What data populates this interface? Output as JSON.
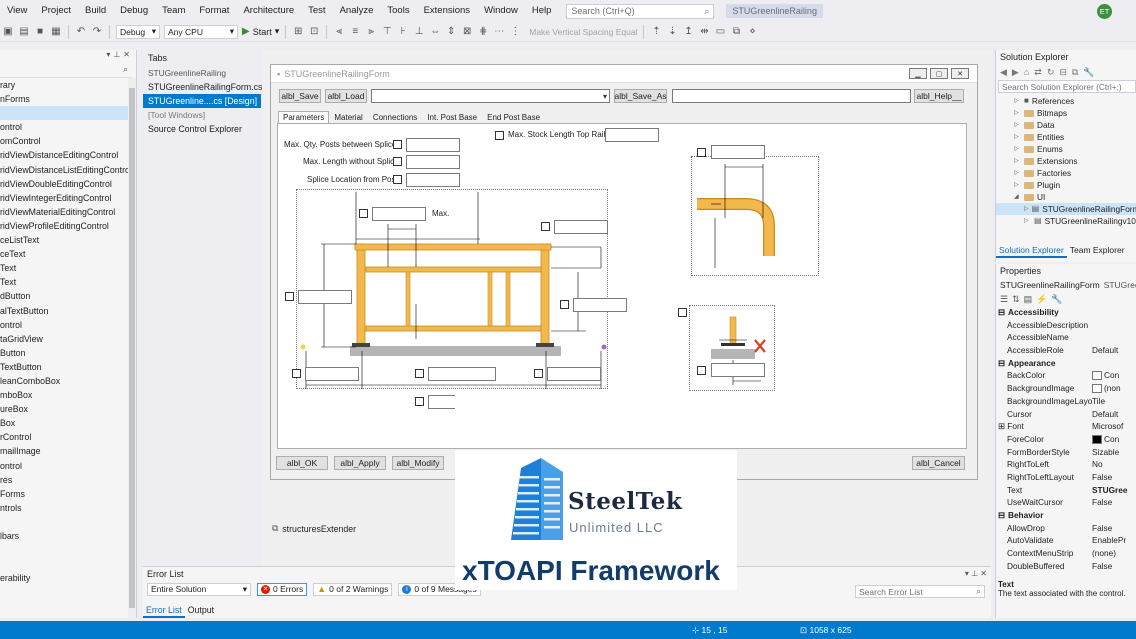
{
  "menubar": {
    "items": [
      "View",
      "Project",
      "Build",
      "Debug",
      "Team",
      "Format",
      "Architecture",
      "Test",
      "Analyze",
      "Tools",
      "Extensions",
      "Window",
      "Help"
    ],
    "search_placeholder": "Search (Ctrl+Q)",
    "title": "STUGreenlineRailing",
    "avatar_initials": "ET"
  },
  "toolbar": {
    "config": "Debug",
    "platform": "Any CPU",
    "start_label": "Start",
    "spacing_label": "Make Vertical Spacing Equal"
  },
  "toolbox": {
    "items": [
      "rary",
      "nForms",
      "",
      "ontrol",
      "omControl",
      "ridViewDistanceEditingControl",
      "ridViewDistanceListEditingControl",
      "ridViewDoubleEditingControl",
      "ridViewIntegerEditingControl",
      "ridViewMaterialEditingControl",
      "ridViewProfileEditingControl",
      "ceListText",
      "ceText",
      "Text",
      "Text",
      "dButton",
      "alTextButton",
      "ontrol",
      "taGridView",
      "Button",
      "TextButton",
      "leanComboBox",
      "mboBox",
      "ureBox",
      "Box",
      "rControl",
      "mailImage",
      "ontrol",
      "res",
      "Forms",
      "ntrols",
      "",
      "lbars",
      "",
      "",
      "erability"
    ],
    "selected_index": 2
  },
  "tabs_panel": {
    "title": "Tabs",
    "section": "STUGreenlineRailing",
    "file": "STUGreenlineRailingForm.cs",
    "active_file": "STUGreenline....cs [Design]",
    "tool_windows": "[Tool Windows]",
    "source_control": "Source Control Explorer"
  },
  "form": {
    "title": "STUGreenlineRailingForm",
    "top_buttons": {
      "save": "albl_Save",
      "load": "albl_Load",
      "save_as": "albl_Save_As",
      "help": "albl_Help__"
    },
    "tabs": [
      "Parameters",
      "Material",
      "Connections",
      "Int. Post Base",
      "End Post Base"
    ],
    "active_tab": 0,
    "labels": {
      "max_stock": "Max. Stock Length Top Rail",
      "max_qty": "Max. Qty. Posts between Splices",
      "max_length": "Max. Length without Splice",
      "splice_location": "Splice Location from Post",
      "max": "Max."
    },
    "bottom_buttons": {
      "ok": "albl_OK",
      "apply": "albl_Apply",
      "modify": "albl_Modify",
      "cancel": "albl_Cancel"
    }
  },
  "extender": "structuresExtender",
  "error_list": {
    "title": "Error List",
    "scope": "Entire Solution",
    "errors": "0 Errors",
    "warnings": "0 of 2 Warnings",
    "messages": "0 of 9 Messages",
    "search_placeholder": "Search Error List",
    "tabs": [
      "Error List",
      "Output"
    ]
  },
  "solution_explorer": {
    "title": "Solution Explorer",
    "search_placeholder": "Search Solution Explorer (Ctrl+;)",
    "items": [
      {
        "label": "References",
        "kind": "refs",
        "indent": 18
      },
      {
        "label": "Bitmaps",
        "kind": "folder",
        "indent": 18
      },
      {
        "label": "Data",
        "kind": "folder",
        "indent": 18
      },
      {
        "label": "Entities",
        "kind": "folder",
        "indent": 18
      },
      {
        "label": "Enums",
        "kind": "folder",
        "indent": 18
      },
      {
        "label": "Extensions",
        "kind": "folder",
        "indent": 18
      },
      {
        "label": "Factories",
        "kind": "folder",
        "indent": 18
      },
      {
        "label": "Plugin",
        "kind": "folder",
        "indent": 18
      },
      {
        "label": "UI",
        "kind": "folder-open",
        "indent": 18
      },
      {
        "label": "STUGreenlineRailingForm",
        "kind": "form",
        "indent": 28,
        "selected": true
      },
      {
        "label": "STUGreenlineRailingv10",
        "kind": "form",
        "indent": 28
      }
    ],
    "tabs": [
      "Solution Explorer",
      "Team Explorer"
    ]
  },
  "properties": {
    "title": "Properties",
    "object": "STUGreenlineRailingForm",
    "object_type": "STUGreenl",
    "rows": [
      {
        "cat": "Accessibility"
      },
      {
        "name": "AccessibleDescription",
        "value": ""
      },
      {
        "name": "AccessibleName",
        "value": ""
      },
      {
        "name": "AccessibleRole",
        "value": "Default"
      },
      {
        "cat": "Appearance"
      },
      {
        "name": "BackColor",
        "value": "Con",
        "swatch": "white"
      },
      {
        "name": "BackgroundImage",
        "value": "(non",
        "swatch": "white"
      },
      {
        "name": "BackgroundImageLayout",
        "value": "Tile"
      },
      {
        "name": "Cursor",
        "value": "Default"
      },
      {
        "name": "Font",
        "value": "Microsof",
        "expand": true
      },
      {
        "name": "ForeColor",
        "value": "Con",
        "swatch": "black"
      },
      {
        "name": "FormBorderStyle",
        "value": "Sizable"
      },
      {
        "name": "RightToLeft",
        "value": "No"
      },
      {
        "name": "RightToLeftLayout",
        "value": "False"
      },
      {
        "name": "Text",
        "value": "STUGree",
        "bold": true
      },
      {
        "name": "UseWaitCursor",
        "value": "False"
      },
      {
        "cat": "Behavior"
      },
      {
        "name": "AllowDrop",
        "value": "False"
      },
      {
        "name": "AutoValidate",
        "value": "EnablePr"
      },
      {
        "name": "ContextMenuStrip",
        "value": "(none)"
      },
      {
        "name": "DoubleBuffered",
        "value": "False"
      }
    ],
    "desc_title": "Text",
    "desc_text": "The text associated with the control."
  },
  "status": {
    "position": "15 , 15",
    "size": "1058 x 625"
  },
  "logo": {
    "name": "SteelTek",
    "sub": "Unlimited LLC",
    "framework": "xTOAPI Framework"
  },
  "colors": {
    "accent": "#007acc",
    "timber": "#f2b84b",
    "timber_dark": "#c88a1e",
    "logo_blue": "#1f7fd6"
  }
}
